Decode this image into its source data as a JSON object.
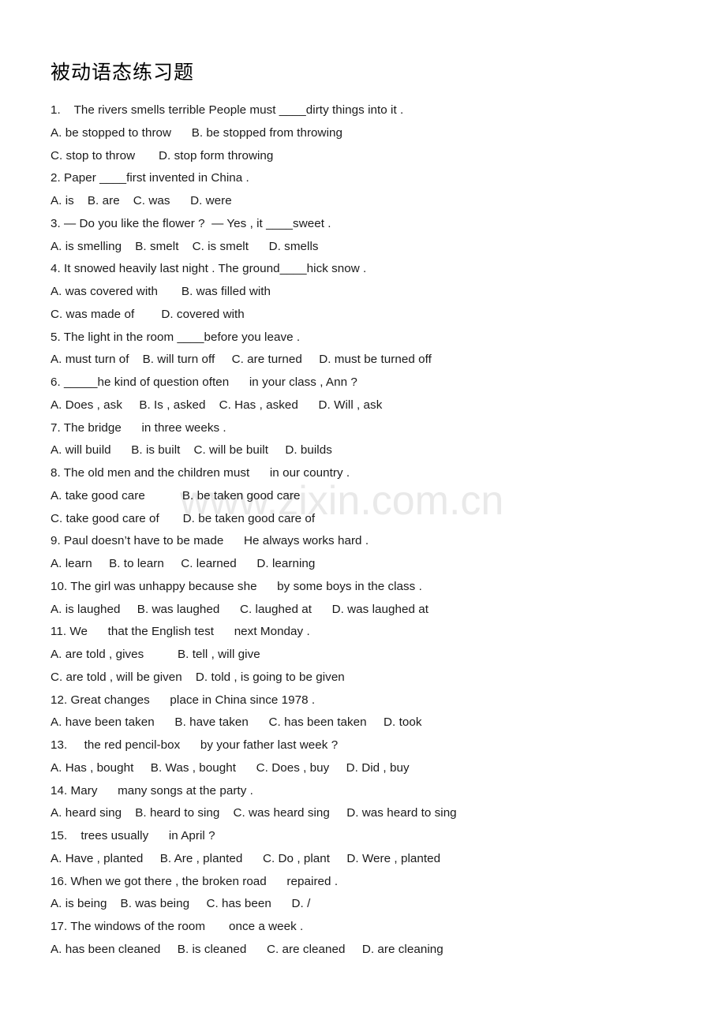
{
  "document": {
    "title": "被动语态练习题",
    "watermark": "www.zixin.com.cn",
    "background_color": "#ffffff",
    "text_color": "#1a1a1a",
    "watermark_color": "#e9e9e9"
  },
  "lines": [
    {
      "id": "q1-stem",
      "type": "question",
      "text": "1.    The rivers smells terrible People must ____dirty things into it ."
    },
    {
      "id": "q1-opt-ab",
      "type": "options",
      "text": "A. be stopped to throw      B. be stopped from throwing"
    },
    {
      "id": "q1-opt-cd",
      "type": "options",
      "text": "C. stop to throw       D. stop form throwing"
    },
    {
      "id": "q2-stem",
      "type": "question",
      "text": "2. Paper ____first invented in China ."
    },
    {
      "id": "q2-opts",
      "type": "options",
      "text": "A. is    B. are    C. was      D. were"
    },
    {
      "id": "q3-stem",
      "type": "question",
      "text": "3. — Do you like the flower ?  — Yes , it ____sweet ."
    },
    {
      "id": "q3-opts",
      "type": "options",
      "text": "A. is smelling    B. smelt    C. is smelt      D. smells"
    },
    {
      "id": "q4-stem",
      "type": "question",
      "text": "4. It snowed heavily last night . The ground____hick snow ."
    },
    {
      "id": "q4-opt-ab",
      "type": "options",
      "text": "A. was covered with       B. was filled with"
    },
    {
      "id": "q4-opt-cd",
      "type": "options",
      "text": "C. was made of        D. covered with"
    },
    {
      "id": "q5-stem",
      "type": "question",
      "text": "5. The light in the room ____before you leave ."
    },
    {
      "id": "q5-opts",
      "type": "options",
      "text": "A. must turn of    B. will turn off     C. are turned     D. must be turned off"
    },
    {
      "id": "q6-stem",
      "type": "question",
      "text": "6. _____he kind of question often      in your class , Ann ?"
    },
    {
      "id": "q6-opts",
      "type": "options",
      "text": "A. Does , ask     B. Is , asked    C. Has , asked      D. Will , ask"
    },
    {
      "id": "q7-stem",
      "type": "question",
      "text": "7. The bridge      in three weeks ."
    },
    {
      "id": "q7-opts",
      "type": "options",
      "text": "A. will build      B. is built    C. will be built     D. builds"
    },
    {
      "id": "q8-stem",
      "type": "question",
      "text": "8. The old men and the children must      in our country ."
    },
    {
      "id": "q8-opt-ab",
      "type": "options",
      "text": "A. take good care           B. be taken good care"
    },
    {
      "id": "q8-opt-cd",
      "type": "options",
      "text": "C. take good care of       D. be taken good care of"
    },
    {
      "id": "q9-stem",
      "type": "question",
      "text": "9. Paul doesn’t have to be made      He always works hard ."
    },
    {
      "id": "q9-opts",
      "type": "options",
      "text": "A. learn     B. to learn     C. learned      D. learning"
    },
    {
      "id": "q10-stem",
      "type": "question",
      "text": "10. The girl was unhappy because she      by some boys in the class ."
    },
    {
      "id": "q10-opts",
      "type": "options",
      "text": "A. is laughed     B. was laughed      C. laughed at      D. was laughed at"
    },
    {
      "id": "q11-stem",
      "type": "question",
      "text": "11. We      that the English test      next Monday ."
    },
    {
      "id": "q11-opt-ab",
      "type": "options",
      "text": "A. are told , gives          B. tell , will give"
    },
    {
      "id": "q11-opt-cd",
      "type": "options",
      "text": "C. are told , will be given    D. told , is going to be given"
    },
    {
      "id": "q12-stem",
      "type": "question",
      "text": "12. Great changes      place in China since 1978 ."
    },
    {
      "id": "q12-opts",
      "type": "options",
      "text": "A. have been taken      B. have taken      C. has been taken     D. took"
    },
    {
      "id": "q13-stem",
      "type": "question",
      "text": "13.     the red pencil-box      by your father last week ?"
    },
    {
      "id": "q13-opts",
      "type": "options",
      "text": "A. Has , bought     B. Was , bought      C. Does , buy     D. Did , buy"
    },
    {
      "id": "q14-stem",
      "type": "question",
      "text": "14. Mary      many songs at the party ."
    },
    {
      "id": "q14-opts",
      "type": "options",
      "text": "A. heard sing    B. heard to sing    C. was heard sing     D. was heard to sing"
    },
    {
      "id": "q15-stem",
      "type": "question",
      "text": "15.    trees usually      in April ?"
    },
    {
      "id": "q15-opts",
      "type": "options",
      "text": "A. Have , planted     B. Are , planted      C. Do , plant     D. Were , planted"
    },
    {
      "id": "q16-stem",
      "type": "question",
      "text": "16. When we got there , the broken road      repaired ."
    },
    {
      "id": "q16-opts",
      "type": "options",
      "text": "A. is being    B. was being     C. has been      D. /"
    },
    {
      "id": "q17-stem",
      "type": "question",
      "text": "17. The windows of the room       once a week ."
    },
    {
      "id": "q17-opts",
      "type": "options",
      "text": "A. has been cleaned     B. is cleaned      C. are cleaned     D. are cleaning"
    }
  ]
}
